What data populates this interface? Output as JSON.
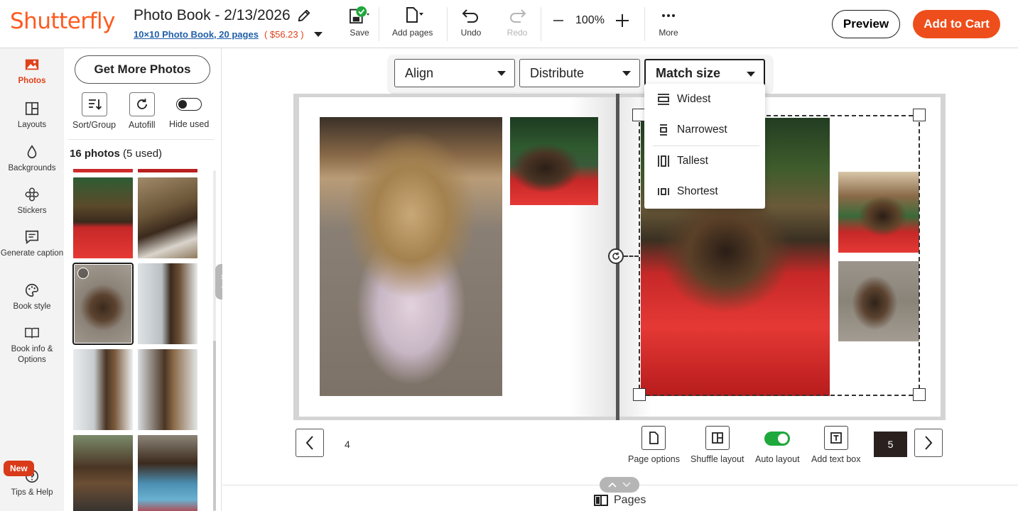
{
  "brand": {
    "logo_text": "Shutterfly",
    "accent": "#ee4e1b"
  },
  "project": {
    "title": "Photo Book - 2/13/2026",
    "product_link": "10×10 Photo Book, 20 pages",
    "price": "( $56.23 )"
  },
  "toolbar": {
    "save_label": "Save",
    "add_pages_label": "Add pages",
    "undo_label": "Undo",
    "redo_label": "Redo",
    "zoom_level": "100%",
    "more_label": "More",
    "preview_label": "Preview",
    "cart_label": "Add to Cart"
  },
  "leftnav": {
    "items": [
      {
        "label": "Photos",
        "icon": "photos-icon",
        "active": true
      },
      {
        "label": "Layouts",
        "icon": "layouts-icon"
      },
      {
        "label": "Backgrounds",
        "icon": "backgrounds-icon"
      },
      {
        "label": "Stickers",
        "icon": "stickers-icon"
      },
      {
        "label": "Generate caption",
        "icon": "caption-icon"
      },
      {
        "label": "Book style",
        "icon": "palette-icon"
      },
      {
        "label": "Book info & Options",
        "icon": "book-icon"
      },
      {
        "label": "Tips & Help",
        "icon": "help-icon"
      }
    ],
    "new_badge": "New"
  },
  "photos_panel": {
    "get_more_label": "Get More Photos",
    "sort_label": "Sort/Group",
    "autofill_label": "Autofill",
    "hide_used_label": "Hide used",
    "count_label": "16 photos",
    "used_label": "(5 used)"
  },
  "arrange": {
    "align_label": "Align",
    "distribute_label": "Distribute",
    "match_size_label": "Match size",
    "match_size_options": [
      "Widest",
      "Narrowest",
      "Tallest",
      "Shortest"
    ]
  },
  "footer": {
    "left_page_number": "4",
    "right_page_number": "5",
    "page_options_label": "Page options",
    "shuffle_layout_label": "Shuffle layout",
    "auto_layout_label": "Auto layout",
    "add_text_box_label": "Add text box",
    "pages_label": "Pages"
  }
}
